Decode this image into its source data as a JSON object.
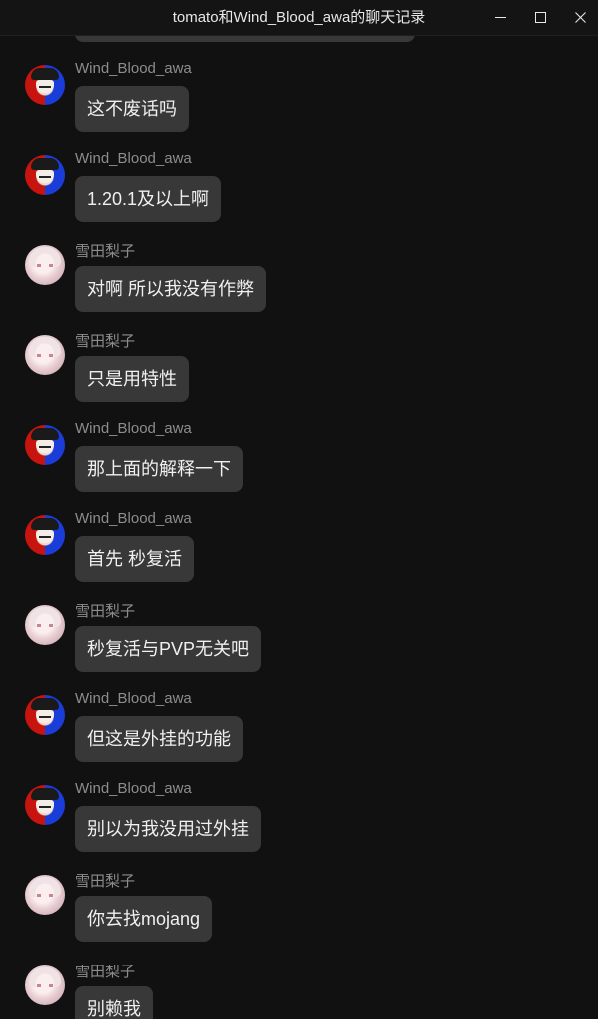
{
  "window": {
    "title": "tomato和Wind_Blood_awa的聊天记录"
  },
  "messages": [
    {
      "sender": "Wind_Blood_awa",
      "avatar": "wind-blood-avatar",
      "text": "这不废话吗"
    },
    {
      "sender": "Wind_Blood_awa",
      "avatar": "wind-blood-avatar",
      "text": "1.20.1及以上啊"
    },
    {
      "sender": "雪田梨子",
      "avatar": "yukida-riko-avatar",
      "text": "对啊 所以我没有作弊"
    },
    {
      "sender": "雪田梨子",
      "avatar": "yukida-riko-avatar",
      "text": "只是用特性"
    },
    {
      "sender": "Wind_Blood_awa",
      "avatar": "wind-blood-avatar",
      "text": "那上面的解释一下"
    },
    {
      "sender": "Wind_Blood_awa",
      "avatar": "wind-blood-avatar",
      "text": "首先 秒复活"
    },
    {
      "sender": "雪田梨子",
      "avatar": "yukida-riko-avatar",
      "text": "秒复活与PVP无关吧"
    },
    {
      "sender": "Wind_Blood_awa",
      "avatar": "wind-blood-avatar",
      "text": "但这是外挂的功能"
    },
    {
      "sender": "Wind_Blood_awa",
      "avatar": "wind-blood-avatar",
      "text": "别以为我没用过外挂"
    },
    {
      "sender": "雪田梨子",
      "avatar": "yukida-riko-avatar",
      "text": "你去找mojang"
    },
    {
      "sender": "雪田梨子",
      "avatar": "yukida-riko-avatar",
      "text": "别赖我"
    }
  ]
}
